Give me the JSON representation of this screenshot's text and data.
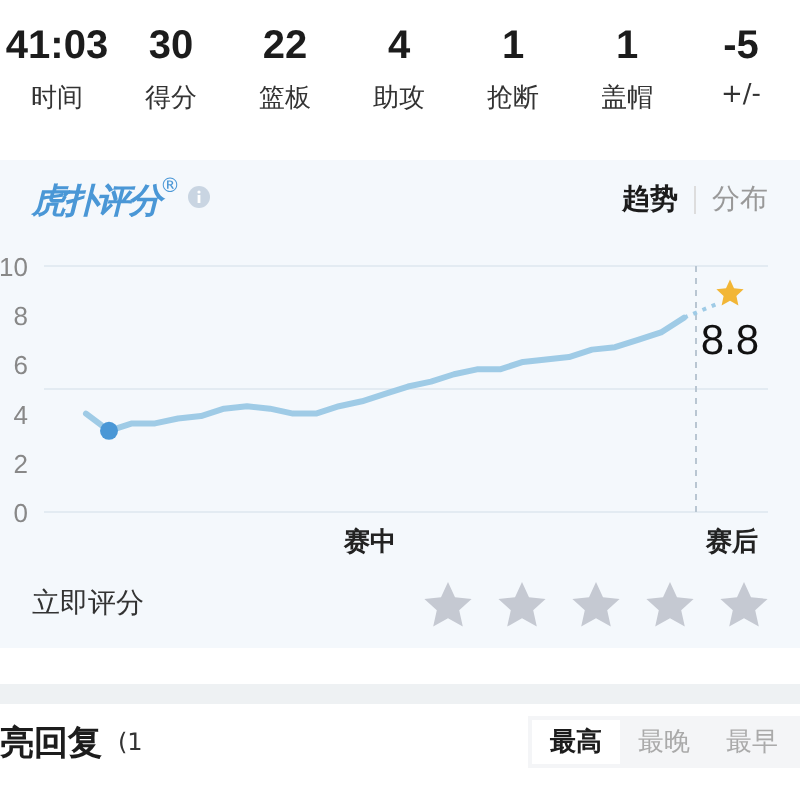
{
  "stats": [
    {
      "value": "41:03",
      "label": "时间"
    },
    {
      "value": "30",
      "label": "得分"
    },
    {
      "value": "22",
      "label": "篮板"
    },
    {
      "value": "4",
      "label": "助攻"
    },
    {
      "value": "1",
      "label": "抢断"
    },
    {
      "value": "1",
      "label": "盖帽"
    },
    {
      "value": "-5",
      "label": "+/-"
    }
  ],
  "rating_card": {
    "logo": "虎扑评分",
    "logo_mark": "®",
    "tabs": [
      {
        "label": "趋势",
        "selected": true
      },
      {
        "label": "分布",
        "selected": false
      }
    ],
    "chart_data": {
      "type": "line",
      "ylim": [
        0,
        10
      ],
      "yticks": [
        0,
        2,
        4,
        6,
        8,
        10
      ],
      "ref_lines": [
        {
          "axis": "y",
          "value": 5
        }
      ],
      "series": [
        {
          "color": "#9fcbe6",
          "values": [
            4.0,
            3.3,
            3.6,
            3.6,
            3.8,
            3.9,
            4.2,
            4.3,
            4.2,
            4.0,
            4.0,
            4.3,
            4.5,
            4.8,
            5.1,
            5.3,
            5.6,
            5.8,
            5.8,
            6.1,
            6.2,
            6.3,
            6.6,
            6.7,
            7.0,
            7.3,
            7.9
          ]
        }
      ]
    },
    "phase_labels": [
      "赛中",
      "赛后"
    ],
    "final_rating": "8.8",
    "rate_prompt": "立即评分",
    "stars": 0
  },
  "comments": {
    "title": "亮回复",
    "count": "(1",
    "sort_tabs": [
      {
        "label": "最高",
        "selected": true
      },
      {
        "label": "最晚",
        "selected": false
      },
      {
        "label": "最早",
        "selected": false
      }
    ]
  }
}
